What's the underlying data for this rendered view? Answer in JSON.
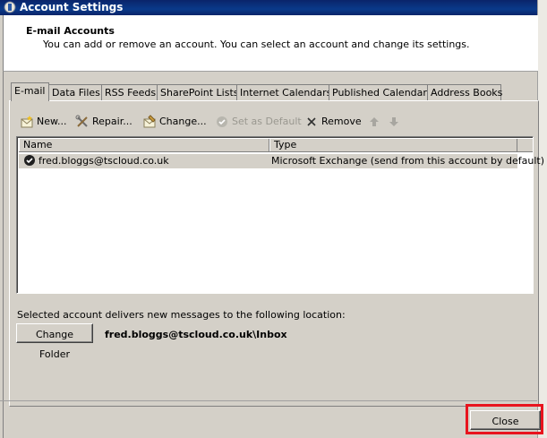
{
  "window": {
    "title": "Account Settings"
  },
  "header": {
    "heading": "E-mail Accounts",
    "subtext": "You can add or remove an account. You can select an account and change its settings."
  },
  "tabs": [
    {
      "label": "E-mail",
      "active": true
    },
    {
      "label": "Data Files"
    },
    {
      "label": "RSS Feeds"
    },
    {
      "label": "SharePoint Lists"
    },
    {
      "label": "Internet Calendars"
    },
    {
      "label": "Published Calendars"
    },
    {
      "label": "Address Books"
    }
  ],
  "toolbar": {
    "new": "New...",
    "repair": "Repair...",
    "change": "Change...",
    "set_default": "Set as Default",
    "remove": "Remove"
  },
  "list": {
    "columns": [
      "Name",
      "Type"
    ],
    "rows": [
      {
        "name": "fred.bloggs@tscloud.co.uk",
        "type": "Microsoft Exchange (send from this account by default)"
      }
    ]
  },
  "delivery": {
    "label": "Selected account delivers new messages to the following location:",
    "change_folder": "Change Folder",
    "location": "fred.bloggs@tscloud.co.uk\\Inbox"
  },
  "footer": {
    "close": "Close"
  },
  "colors": {
    "titlebar": "#0a246a",
    "highlight": "#e8141e"
  }
}
